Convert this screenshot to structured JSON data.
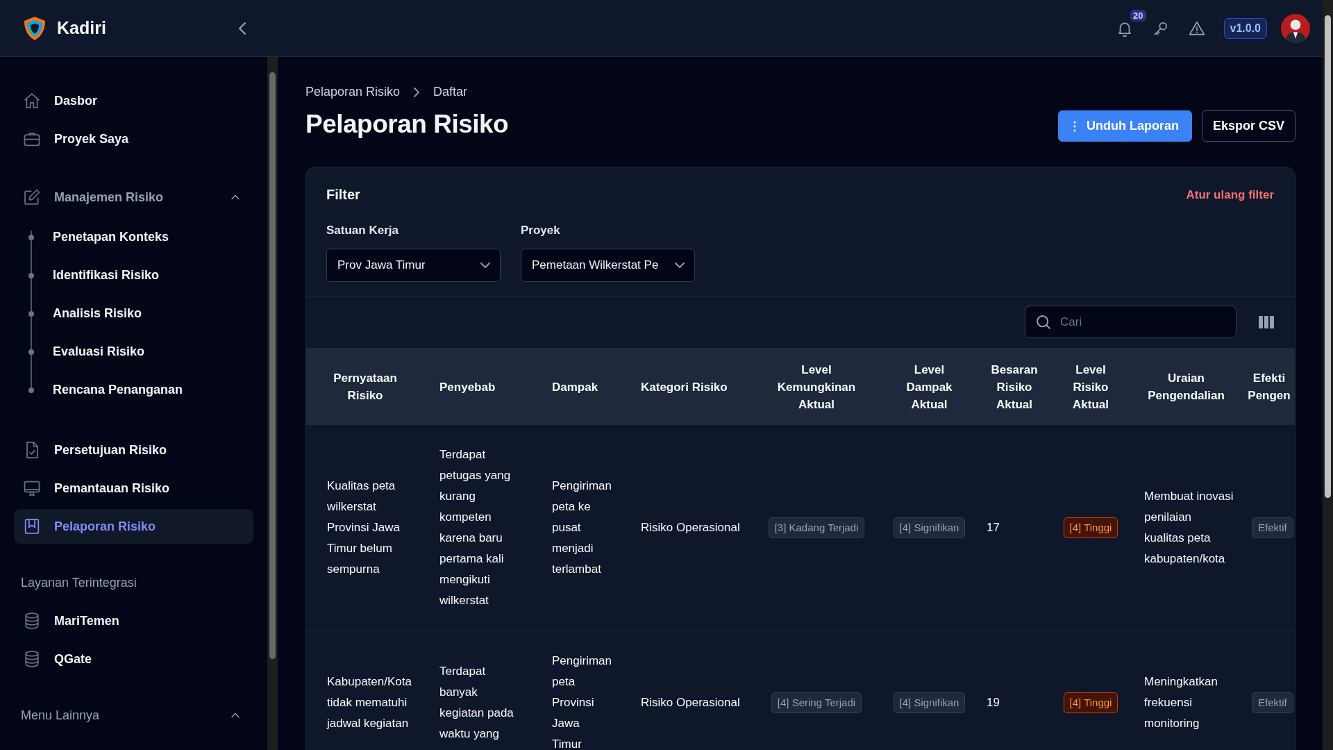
{
  "app": {
    "name": "Kadiri"
  },
  "topbar": {
    "notification_count": "20",
    "version": "v1.0.0"
  },
  "sidebar": {
    "groups": [
      {
        "items": [
          {
            "label": "Dasbor",
            "selected": false
          },
          {
            "label": "Proyek Saya",
            "selected": false
          }
        ]
      },
      {
        "items": [
          {
            "label": "Manajemen Risiko",
            "selected": false,
            "expanded": true,
            "children": [
              {
                "label": "Penetapan Konteks",
                "selected": false
              },
              {
                "label": "Identifikasi Risiko",
                "selected": false
              },
              {
                "label": "Analisis Risiko",
                "selected": false
              },
              {
                "label": "Evaluasi Risiko",
                "selected": false
              },
              {
                "label": "Rencana Penanganan",
                "selected": false
              }
            ]
          }
        ]
      },
      {
        "items": [
          {
            "label": "Persetujuan Risiko",
            "selected": false
          },
          {
            "label": "Pemantauan Risiko",
            "selected": false
          },
          {
            "label": "Pelaporan Risiko",
            "selected": true
          }
        ]
      },
      {
        "heading": "Layanan Terintegrasi",
        "items": [
          {
            "label": "MariTemen",
            "selected": false
          },
          {
            "label": "QGate",
            "selected": false
          }
        ]
      },
      {
        "heading": "Menu Lainnya",
        "expanded": true
      }
    ]
  },
  "breadcrumb": [
    "Pelaporan Risiko",
    "Daftar"
  ],
  "title": "Pelaporan Risiko",
  "actions": [
    {
      "label": "Unduh Laporan",
      "kind": "primary"
    },
    {
      "label": "Ekspor CSV",
      "kind": "outline"
    }
  ],
  "filter": {
    "title": "Filter",
    "reset": "Atur ulang filter",
    "fields": [
      {
        "label": "Satuan Kerja",
        "value": "Prov Jawa Timur"
      },
      {
        "label": "Proyek",
        "value": "Pemetaan Wilkerstat Pe"
      }
    ]
  },
  "search": {
    "placeholder": "Cari"
  },
  "table": {
    "columns": [
      "Pernyataan Risiko",
      "Penyebab",
      "Dampak",
      "Kategori Risiko",
      "Level Kemungkinan Aktual",
      "Level Dampak Aktual",
      "Besaran Risiko Aktual",
      "Level Risiko Aktual",
      "Uraian Pengendalian",
      "Efekti Pengen"
    ],
    "rows": [
      {
        "cells": [
          {
            "kind": "text",
            "text": "Kualitas peta wilkerstat Provinsi Jawa Timur belum sempurna"
          },
          {
            "kind": "text",
            "text": "Terdapat petugas yang kurang kompeten karena baru pertama kali mengikuti wilkerstat"
          },
          {
            "kind": "text",
            "text": "Pengiriman peta ke pusat menjadi terlambat"
          },
          {
            "kind": "text",
            "text": "Risiko Operasional"
          },
          {
            "kind": "badge",
            "text": "[3] Kadang Terjadi"
          },
          {
            "kind": "badge",
            "text": "[4] Signifikan"
          },
          {
            "kind": "text",
            "text": "17"
          },
          {
            "kind": "alert_badge",
            "text": "[4] Tinggi"
          },
          {
            "kind": "text",
            "text": "Membuat inovasi penilaian kualitas peta kabupaten/kota"
          },
          {
            "kind": "badge",
            "text": "Efektif"
          }
        ]
      },
      {
        "cells": [
          {
            "kind": "text",
            "text": "Kabupaten/Kota tidak mematuhi jadwal kegiatan"
          },
          {
            "kind": "text",
            "text": "Terdapat banyak kegiatan pada waktu yang"
          },
          {
            "kind": "text",
            "text": "Pengiriman peta Provinsi Jawa Timur"
          },
          {
            "kind": "text",
            "text": "Risiko Operasional"
          },
          {
            "kind": "badge",
            "text": "[4] Sering Terjadi"
          },
          {
            "kind": "badge",
            "text": "[4] Signifikan"
          },
          {
            "kind": "text",
            "text": "19"
          },
          {
            "kind": "alert_badge",
            "text": "[4] Tinggi"
          },
          {
            "kind": "text",
            "text": "Meningkatkan frekuensi monitoring"
          },
          {
            "kind": "badge",
            "text": "Efektif"
          }
        ]
      }
    ]
  }
}
